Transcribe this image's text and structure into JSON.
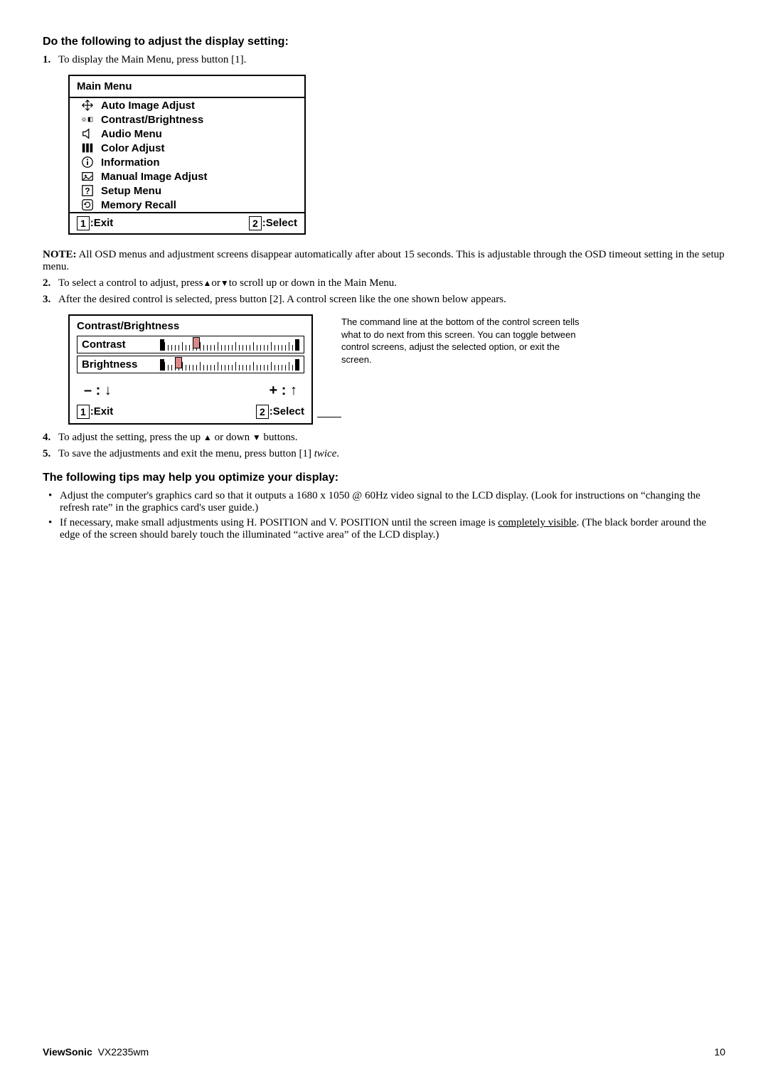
{
  "heading1": "Do the following to adjust the display setting:",
  "step1": {
    "num": "1.",
    "text": "To display the Main Menu, press button [1]."
  },
  "mainMenu": {
    "title": "Main Menu",
    "items": [
      "Auto Image Adjust",
      "Contrast/Brightness",
      "Audio Menu",
      "Color Adjust",
      "Information",
      "Manual Image Adjust",
      "Setup Menu",
      "Memory Recall"
    ],
    "footerLeft": ":Exit",
    "footerLeftKey": "1",
    "footerRight": ":Select",
    "footerRightKey": "2"
  },
  "noteLabel": "NOTE:",
  "noteText": " All OSD menus and adjustment screens disappear automatically after about 15 seconds. This is adjustable through the OSD timeout setting in the setup menu.",
  "step2": {
    "num": "2.",
    "pre": "To select a control to adjust, press",
    "post": "to scroll up or down in the Main Menu."
  },
  "step3": {
    "num": "3.",
    "text": "After the desired control is selected, press button [2]. A control screen like the one shown below appears."
  },
  "contrastBox": {
    "title": "Contrast/Brightness",
    "row1": "Contrast",
    "row2": "Brightness",
    "arrL_minus": "– :",
    "arrL_sym": "↓",
    "arrR_plus": "+ :",
    "arrR_sym": "↑",
    "footerLeftKey": "1",
    "footerLeft": ":Exit",
    "footerRightKey": "2",
    "footerRight": ":Select"
  },
  "cmdNote": "The command line at the bottom of the control screen tells what to do next from this screen. You can toggle between control screens, adjust the selected option, or exit the screen.",
  "step4": {
    "num": "4.",
    "pre": "To adjust the setting, press the up ",
    "mid": " or down ",
    "post": " buttons."
  },
  "step5": {
    "num": "5.",
    "preText": "To save the adjustments and exit the menu, press button [1] ",
    "twice": "twice",
    "period": "."
  },
  "heading2": "The following tips may help you optimize your display:",
  "tip1": "Adjust the computer's graphics card so that it outputs a 1680 x 1050 @ 60Hz video signal to the LCD display. (Look for instructions on “changing the refresh rate” in the graphics card's user guide.)",
  "tip2_pre": "If necessary, make small adjustments using H. POSITION and V. POSITION until the screen image is ",
  "tip2_underlined": "completely visible",
  "tip2_post": ". (The black border around the edge of the screen should barely touch the illuminated “active area” of the LCD display.)",
  "footer": {
    "brand": "ViewSonic",
    "model": "VX2235wm",
    "page": "10"
  }
}
